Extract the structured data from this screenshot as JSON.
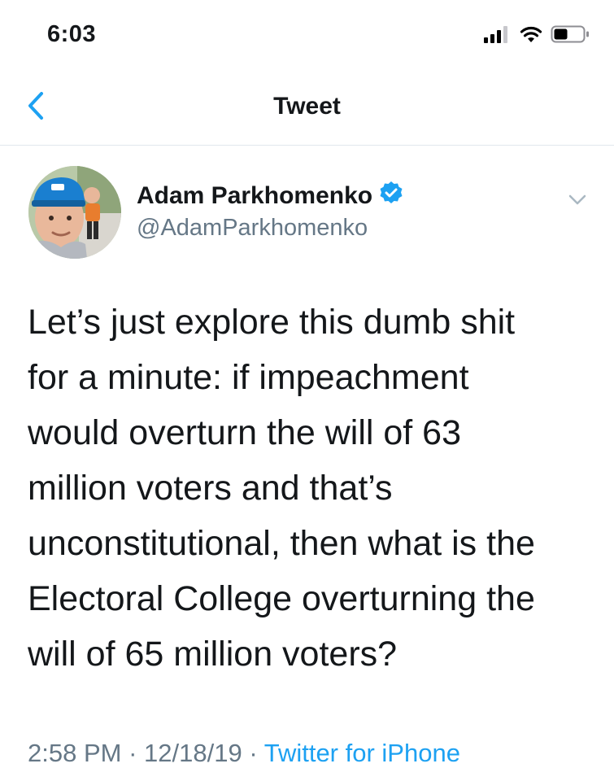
{
  "status_bar": {
    "time": "6:03",
    "icons": [
      "signal-icon",
      "wifi-icon",
      "battery-icon"
    ]
  },
  "nav": {
    "back_icon": "chevron-left-icon",
    "title": "Tweet",
    "accent_color": "#1da1f2"
  },
  "tweet": {
    "author_name": "Adam Parkhomenko",
    "verified_icon": "verified-badge-icon",
    "handle": "@AdamParkhomenko",
    "menu_icon": "chevron-down-icon",
    "text": "Let’s just explore this dumb shit\nfor a minute: if impeachment\nwould overturn the will of 63\nmillion voters and that’s\nunconstitutional, then what is the\nElectoral College overturning the\nwill of 65 million voters?",
    "time": "2:58 PM",
    "separator": "·",
    "date": "12/18/19",
    "source": "Twitter for iPhone"
  }
}
